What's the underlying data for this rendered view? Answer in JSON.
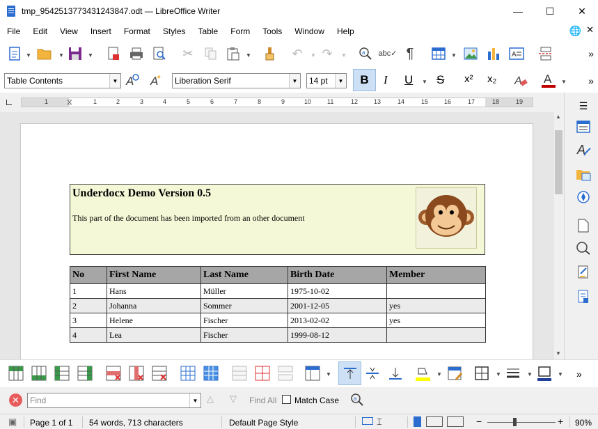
{
  "window": {
    "title": "tmp_9542513773431243847.odt — LibreOffice Writer",
    "minimize": "—",
    "maximize": "☐",
    "close": "✕"
  },
  "menu": [
    "File",
    "Edit",
    "View",
    "Insert",
    "Format",
    "Styles",
    "Table",
    "Form",
    "Tools",
    "Window",
    "Help"
  ],
  "formatting": {
    "paragraph_style": "Table Contents",
    "font_name": "Liberation Serif",
    "font_size": "14 pt",
    "bold": "B",
    "italic": "I",
    "underline": "U",
    "strike": "S",
    "superscript": "x²",
    "subscript": "x₂"
  },
  "ruler": {
    "ticks": [
      "1",
      "1",
      "2",
      "3",
      "4",
      "5",
      "6",
      "7",
      "8",
      "9",
      "10",
      "11",
      "12",
      "13",
      "14",
      "15",
      "16",
      "17",
      "18",
      "19"
    ]
  },
  "document": {
    "frame": {
      "heading": "Underdocx Demo Version 0.5",
      "text": "This part of the document has been imported from an other document"
    },
    "table": {
      "headers": [
        "No",
        "First Name",
        "Last Name",
        "Birth Date",
        "Member"
      ],
      "rows": [
        [
          "1",
          "Hans",
          "Müller",
          "1975-10-02",
          ""
        ],
        [
          "2",
          "Johanna",
          "Sommer",
          "2001-12-05",
          "yes"
        ],
        [
          "3",
          "Helene",
          "Fischer",
          "2013-02-02",
          "yes"
        ],
        [
          "4",
          "Lea",
          "Fischer",
          "1999-08-12",
          ""
        ]
      ]
    }
  },
  "find": {
    "placeholder": "Find",
    "find_all": "Find All",
    "match_case": "Match Case"
  },
  "status": {
    "page": "Page 1 of 1",
    "words": "54 words, 713 characters",
    "page_style": "Default Page Style",
    "zoom": "90%"
  },
  "colors": {
    "accent": "#2b6ccf",
    "frame_bg": "#f5f8d6",
    "header_bg": "#a6a6a6",
    "highlight": "#ffff00",
    "font_color": "#c00000"
  }
}
